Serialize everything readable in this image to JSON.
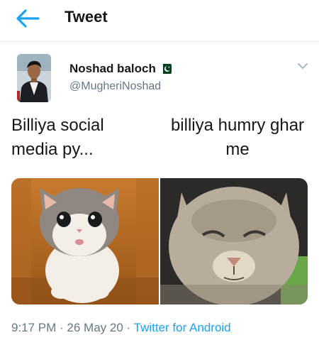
{
  "header": {
    "title": "Tweet"
  },
  "author": {
    "name": "Noshad baloch",
    "handle": "@MugheriNoshad"
  },
  "captions": {
    "left": "Billiya social media py...",
    "right": "billiya humry ghar me"
  },
  "footer": {
    "time": "9:17 PM",
    "sep1": " · ",
    "date": "26 May 20",
    "sep2": " · ",
    "source": "Twitter for Android"
  },
  "colors": {
    "accent": "#1da1f2",
    "secondary_text": "#657786",
    "flag_green": "#01411c"
  },
  "icons": {
    "back": "arrow-left",
    "flag": "pakistan-flag",
    "menu": "chevron-down"
  }
}
